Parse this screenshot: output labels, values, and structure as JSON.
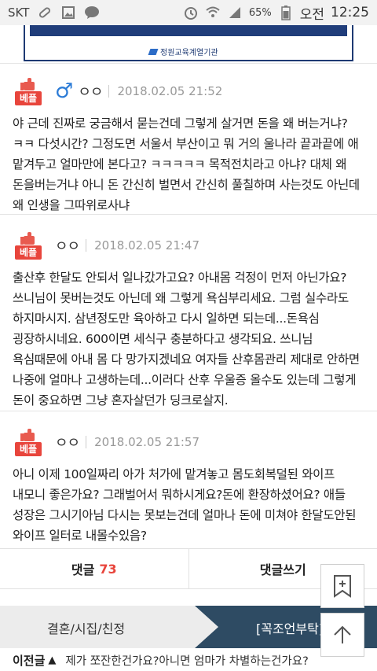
{
  "status_bar": {
    "carrier": "SKT",
    "battery": "65%",
    "ampm": "오전",
    "time": "12:25"
  },
  "banner": {
    "org": "정원교육계열기관"
  },
  "comments": [
    {
      "badge": "베플",
      "gender_icon": "male",
      "author": "ㅇㅇ",
      "date": "2018.02.05 21:52",
      "text": "야 근데 진짜로 궁금해서 묻는건데 그렇게 살거면 돈을 왜 버는거냐? ㅋㅋ 다섯시간? 그정도면 서울서 부산이고 뭐 거의 울나라 끝과끝에 애 맡겨두고 얼마만에 본다고? ㅋㅋㅋㅋㅋ 목적전치라고 아냐? 대체 왜 돈을버는거냐 아니 돈 간신히 벌면서 간신히 풀칠하며 사는것도 아닌데 왜 인생을 그따위로사냐"
    },
    {
      "badge": "베플",
      "author": "ㅇㅇ",
      "date": "2018.02.05 21:47",
      "text": "출산후 한달도 안되서 일나갔가고요? 아내몸 걱정이 먼저 아닌가요? 쓰니님이 못버는것도 아닌데 왜 그렇게 욕심부리세요. 그럼 실수라도 하지마시지. 삼년정도만 육아하고 다시 일하면 되는데...돈욕심 굉장하시네요. 600이면 세식구 충분하다고 생각되요. 쓰니님 욕심때문에 아내 몸 다 망가지겠네요 여자들 산후몸관리 제대로 안하면 나중에 얼마나 고생하는데...이러다 산후 우울증 올수도 있는데 그렇게 돈이 중요하면 그냥 혼자살던가 딩크로살지."
    },
    {
      "badge": "베플",
      "author": "ㅇㅇ",
      "date": "2018.02.05 21:57",
      "text": "아니 이제 100일짜리 아가 처가에 맡겨놓고 몸도회복덜된 와이프 내모니 좋은가요? 그래벌어서 뭐하시게요?돈에 환장하셨어요? 애들 성장은 그시기아님 다시는 못보는건데 얼마나 돈에 미쳐야 한달도안된 와이프 일터로 내몰수있음?"
    }
  ],
  "actions": {
    "comments_label": "댓글",
    "comments_count": "73",
    "write_label": "댓글쓰기"
  },
  "category": {
    "name": "결혼/시집/친정",
    "tag": "[꼭조언부탁]"
  },
  "prev_post": {
    "label": "이전글",
    "title": "제가 쪼잔한건가요?아니면 엄마가 차별하는건가요?"
  },
  "colors": {
    "best_badge": "#e8453c",
    "male_icon": "#2b7bd6",
    "category_block": "#2e4b63"
  }
}
